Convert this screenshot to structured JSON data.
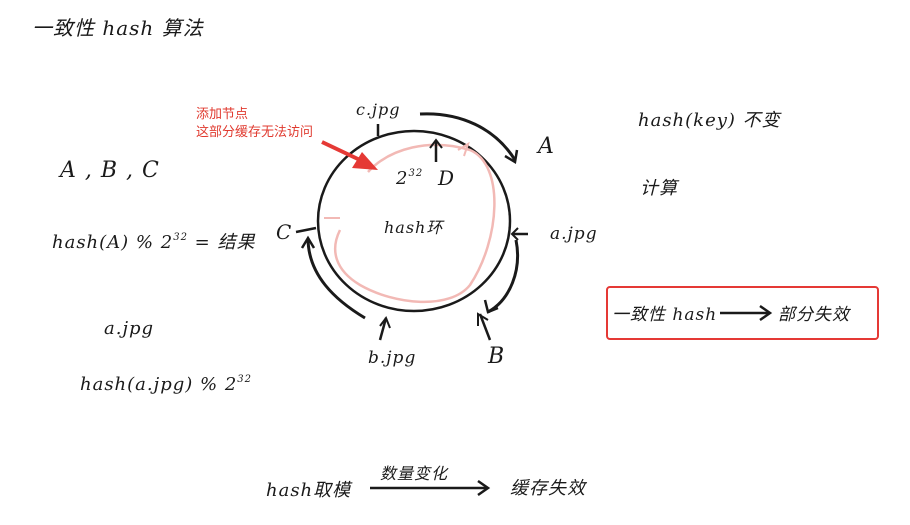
{
  "title": "一致性 hash 算法",
  "nodes_list": "A , B , C",
  "formula_node": {
    "text": "hash(A) % 2",
    "exp": "32",
    "result": "= 结果"
  },
  "file_label": "a.jpg",
  "formula_file": {
    "text": "hash(a.jpg) % 2",
    "exp": "32"
  },
  "ring": {
    "center_label": "hash环",
    "max_label": "2",
    "max_exp": "32",
    "nodes": {
      "A": "A",
      "B": "B",
      "C": "C",
      "D": "D"
    },
    "files": {
      "c": "c.jpg",
      "a": "a.jpg",
      "b": "b.jpg"
    }
  },
  "annotation": {
    "line1": "添加节点",
    "line2": "这部分缓存无法访问",
    "color": "#e03a2f"
  },
  "right_notes": {
    "note1": "hash(key) 不变",
    "note2": "计算"
  },
  "highlight_box": {
    "left": "一致性 hash",
    "right": "部分失效",
    "border_color": "#e53935"
  },
  "bottom_flow": {
    "left": "hash取模",
    "middle": "数量变化",
    "right": "缓存失效"
  }
}
